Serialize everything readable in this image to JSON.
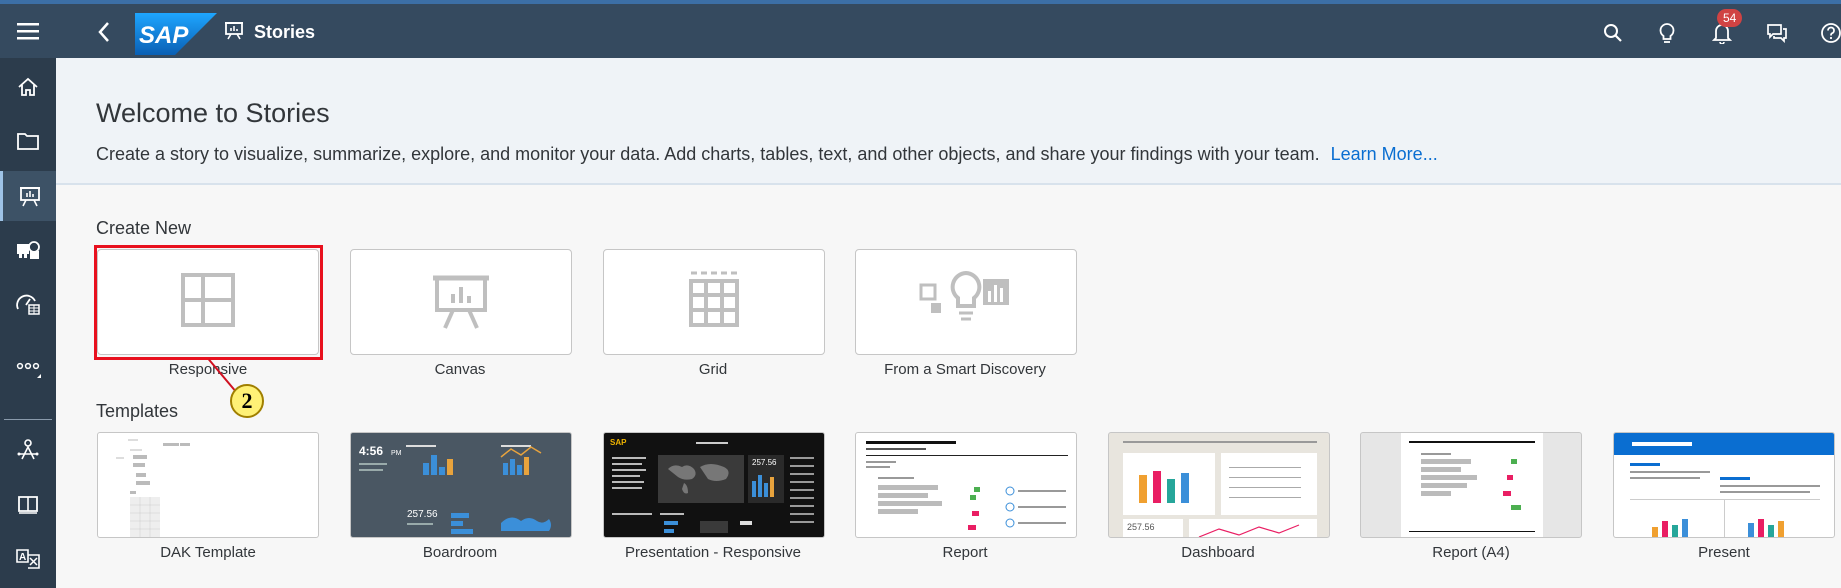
{
  "shell": {
    "logo_text": "SAP",
    "app_title": "Stories",
    "notification_count": "54",
    "icons": [
      "menu-icon",
      "back-icon",
      "stories-icon",
      "search-icon",
      "lightbulb-icon",
      "bell-icon",
      "chat-icon",
      "help-icon"
    ]
  },
  "sidenav": {
    "items": [
      "home-icon",
      "folder-icon",
      "stories-icon",
      "data-icon",
      "analytic-icon",
      "more-icon",
      "connections-icon",
      "book-icon",
      "translate-icon"
    ]
  },
  "welcome": {
    "title": "Welcome to Stories",
    "description": "Create a story to visualize, summarize, explore, and monitor your data. Add charts, tables, text, and other objects, and share your findings with your team.",
    "link": "Learn More..."
  },
  "create_new": {
    "label": "Create New",
    "tiles": [
      {
        "label": "Responsive",
        "icon": "responsive-layout-icon"
      },
      {
        "label": "Canvas",
        "icon": "canvas-icon"
      },
      {
        "label": "Grid",
        "icon": "grid-icon"
      },
      {
        "label": "From a Smart Discovery",
        "icon": "smart-discovery-icon"
      }
    ]
  },
  "callout": {
    "number": "2"
  },
  "templates": {
    "label": "Templates",
    "items": [
      {
        "label": "DAK Template"
      },
      {
        "label": "Boardroom",
        "time": "4:56",
        "time_suffix": "PM",
        "value": "257.56"
      },
      {
        "label": "Presentation - Responsive",
        "logo": "SAP",
        "value": "257.56"
      },
      {
        "label": "Report"
      },
      {
        "label": "Dashboard",
        "value": "257.56"
      },
      {
        "label": "Report (A4)"
      },
      {
        "label": "Present"
      }
    ]
  },
  "colors": {
    "shell": "#354a5f",
    "sidenav": "#2c3c4c",
    "accent": "#0a6ed1",
    "highlight": "#e8101e"
  }
}
